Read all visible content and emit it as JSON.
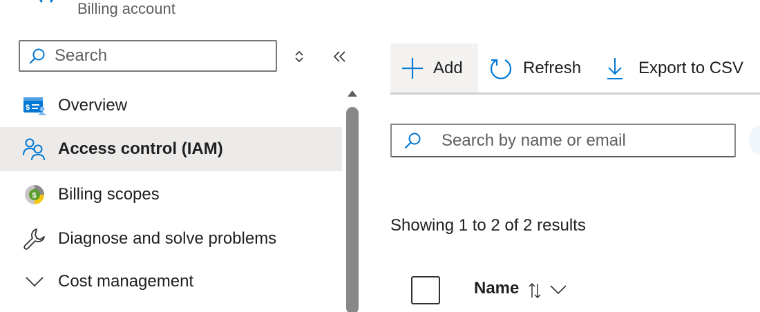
{
  "header": {
    "subtitle": "Billing account",
    "logo_icon": "user-icon"
  },
  "sidebar": {
    "search": {
      "placeholder": "Search"
    },
    "icons": {
      "sort": "updown-icon",
      "collapse": "double-chevron-left-icon"
    },
    "items": [
      {
        "label": "Overview",
        "icon": "billing-overview-icon",
        "active": false
      },
      {
        "label": "Access control (IAM)",
        "icon": "people-icon",
        "active": true
      },
      {
        "label": "Billing scopes",
        "icon": "billing-scope-icon",
        "active": false
      },
      {
        "label": "Diagnose and solve problems",
        "icon": "wrench-icon",
        "active": false
      },
      {
        "label": "Cost management",
        "icon": "chevron-down-icon",
        "active": false
      }
    ]
  },
  "toolbar": {
    "add_label": "Add",
    "refresh_label": "Refresh",
    "export_label": "Export to CSV"
  },
  "main": {
    "search": {
      "placeholder": "Search by name or email"
    },
    "results_text": "Showing 1 to 2 of 2 results",
    "table": {
      "columns": [
        {
          "label": "Name"
        }
      ]
    }
  },
  "colors": {
    "accent": "#0078d4",
    "active_bg": "#edebe9",
    "text": "#1f1f1f",
    "muted": "#605e5c"
  }
}
